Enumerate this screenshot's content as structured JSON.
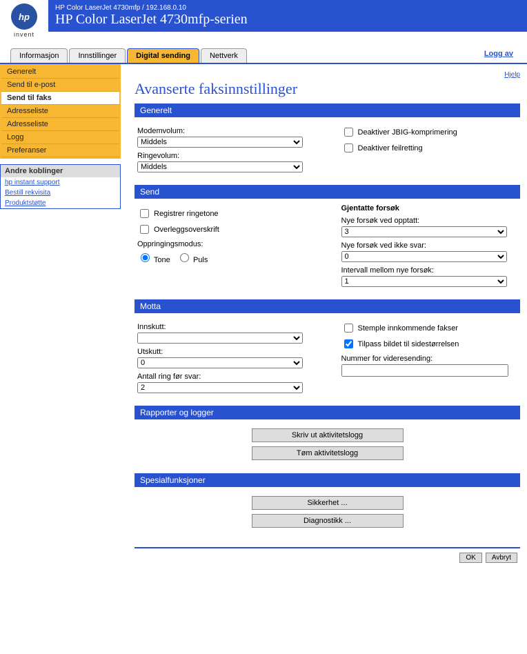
{
  "header": {
    "logo_text": "hp",
    "logo_sub": "invent",
    "subtitle": "HP Color LaserJet 4730mfp / 192.168.0.10",
    "title": "HP Color LaserJet 4730mfp-serien"
  },
  "tabs": {
    "info": "Informasjon",
    "settings": "Innstillinger",
    "digital": "Digital sending",
    "network": "Nettverk",
    "logoff": "Logg av"
  },
  "sidebar": {
    "items": [
      "Generelt",
      "Send til e-post",
      "Send til faks",
      "Adresseliste",
      "Adresseliste",
      "Logg",
      "Preferanser"
    ],
    "box_title": "Andre koblinger",
    "links": [
      "hp instant support",
      "Bestill rekvisita",
      "Produktstøtte"
    ]
  },
  "page": {
    "help": "Hjelp",
    "title": "Avanserte faksinnstillinger"
  },
  "sections": {
    "general": {
      "title": "Generelt",
      "modem_label": "Modemvolum:",
      "modem_value": "Middels",
      "ring_label": "Ringevolum:",
      "ring_value": "Middels",
      "jbig": "Deaktiver JBIG-komprimering",
      "errcorr": "Deaktiver feilretting"
    },
    "send": {
      "title": "Send",
      "reg_tone": "Registrer ringetone",
      "overlay": "Overleggsoverskrift",
      "dial_mode_label": "Oppringingsmodus:",
      "tone": "Tone",
      "pulse": "Puls",
      "retry_heading": "Gjentatte forsøk",
      "retry_busy_label": "Nye forsøk ved opptatt:",
      "retry_busy_value": "3",
      "retry_noans_label": "Nye forsøk ved ikke svar:",
      "retry_noans_value": "0",
      "retry_interval_label": "Intervall mellom nye forsøk:",
      "retry_interval_value": "1"
    },
    "receive": {
      "title": "Motta",
      "insert_label": "Innskutt:",
      "insert_value": "",
      "print_label": "Utskutt:",
      "print_value": "0",
      "rings_label": "Antall ring før svar:",
      "rings_value": "2",
      "stamp": "Stemple innkommende fakser",
      "fit": "Tilpass bildet til sidestørrelsen",
      "forward_label": "Nummer for videresending:"
    },
    "reports": {
      "title": "Rapporter og logger",
      "print_log": "Skriv ut aktivitetslogg",
      "clear_log": "Tøm aktivitetslogg"
    },
    "special": {
      "title": "Spesialfunksjoner",
      "security": "Sikkerhet ...",
      "diag": "Diagnostikk ..."
    }
  },
  "footer": {
    "ok": "OK",
    "cancel": "Avbryt"
  }
}
